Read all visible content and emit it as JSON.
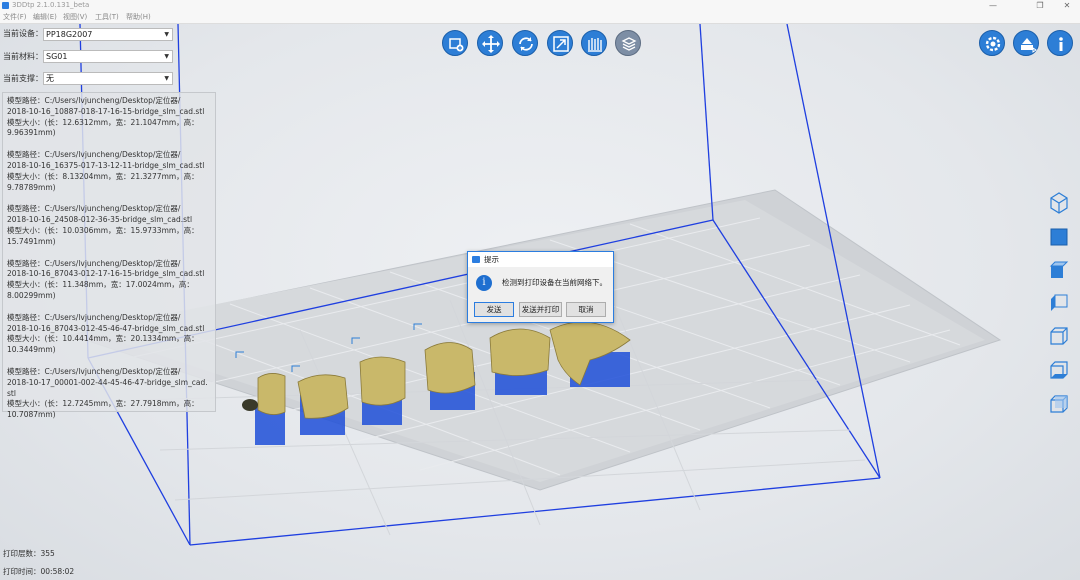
{
  "app": {
    "title": "3DDtp 2.1.0.131_beta"
  },
  "window_controls": {
    "minimize": "—",
    "restore": "❐",
    "close": "✕"
  },
  "menu": [
    "文件(F)",
    "编辑(E)",
    "视图(V)",
    "工具(T)",
    "帮助(H)"
  ],
  "fields": {
    "device": {
      "label": "当前设备：",
      "value": "PP18G2007"
    },
    "material": {
      "label": "当前材料：",
      "value": "SG01"
    },
    "support": {
      "label": "当前支撑：",
      "value": "无"
    }
  },
  "models": [
    {
      "path_label": "模型路径：C:/Users/lvjuncheng/Desktop/定位器/",
      "file": "2018-10-16_10887-018-17-16-15-bridge_slm_cad.stl",
      "size": "模型大小：(长：12.6312mm，宽：21.1047mm，高：",
      "height": "9.96391mm)"
    },
    {
      "path_label": "模型路径：C:/Users/lvjuncheng/Desktop/定位器/",
      "file": "2018-10-16_16375-017-13-12-11-bridge_slm_cad.stl",
      "size": "模型大小：(长：8.13204mm，宽：21.3277mm，高：",
      "height": "9.78789mm)"
    },
    {
      "path_label": "模型路径：C:/Users/lvjuncheng/Desktop/定位器/",
      "file": "2018-10-16_24508-012-36-35-bridge_slm_cad.stl",
      "size": "模型大小：(长：10.0306mm，宽：15.9733mm，高：",
      "height": "15.7491mm)"
    },
    {
      "path_label": "模型路径：C:/Users/lvjuncheng/Desktop/定位器/",
      "file": "2018-10-16_87043-012-17-16-15-bridge_slm_cad.stl",
      "size": "模型大小：(长：11.348mm，宽：17.0024mm，高：",
      "height": "8.00299mm)"
    },
    {
      "path_label": "模型路径：C:/Users/lvjuncheng/Desktop/定位器/",
      "file": "2018-10-16_87043-012-45-46-47-bridge_slm_cad.stl",
      "size": "模型大小：(长：10.4414mm，宽：20.1334mm，高：",
      "height": "10.3449mm)"
    },
    {
      "path_label": "模型路径：C:/Users/lvjuncheng/Desktop/定位器/",
      "file": "2018-10-17_00001-002-44-45-46-47-bridge_slm_cad.stl",
      "size": "模型大小：(长：12.7245mm，宽：27.7918mm，高：",
      "height": "10.7087mm)"
    }
  ],
  "toolbar_icons": [
    "add-model-icon",
    "move-icon",
    "rotate-icon",
    "scale-icon",
    "support-icon",
    "slice-icon"
  ],
  "right_icons": [
    "settings-icon",
    "print-send-icon",
    "info-icon"
  ],
  "view_icons": [
    "view-iso-icon",
    "view-front-icon",
    "view-top-icon",
    "view-left-icon",
    "view-right-icon",
    "view-bottom-icon",
    "view-back-icon"
  ],
  "dialog": {
    "title": "提示",
    "message": "检测到打印设备在当前网络下。",
    "buttons": {
      "send": "发送",
      "send_print": "发送并打印",
      "cancel": "取消"
    }
  },
  "status": {
    "layers_label": "打印层数：",
    "layers_value": "355",
    "time_label": "打印时间：",
    "time_value": "00:58:02"
  },
  "colors": {
    "accent": "#2d7ed6",
    "build_box": "#1f3fe0",
    "model": "#c9b86a",
    "support": "#1f4fd8"
  }
}
